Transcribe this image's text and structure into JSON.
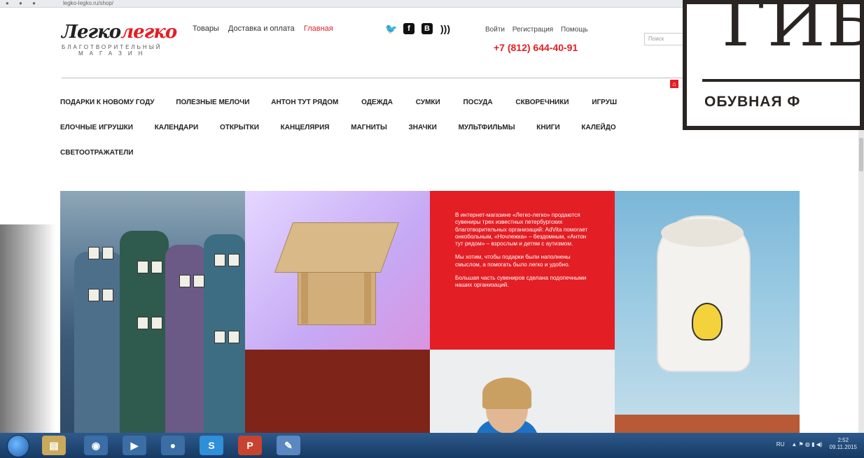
{
  "browser": {
    "url": "legko-legko.ru/shop/"
  },
  "logo": {
    "name_part1": "Легко",
    "name_part2": "легко",
    "line1": "БЛАГОТВОРИТЕЛЬНЫЙ",
    "line2": "МАГАЗИН"
  },
  "top_nav": [
    "Товары",
    "Доставка и оплата",
    "Главная"
  ],
  "social_icons": [
    "twitter-icon",
    "facebook-icon",
    "vk-icon",
    "rss-icon"
  ],
  "account_links": [
    "Войти",
    "Регистрация",
    "Помощь"
  ],
  "phone": "+7 (812) 644-40-91",
  "search": {
    "placeholder": "Поиск"
  },
  "menu_row1": [
    "ПОДАРКИ К НОВОМУ ГОДУ",
    "ПОЛЕЗНЫЕ МЕЛОЧИ",
    "АНТОН ТУТ РЯДОМ",
    "ОДЕЖДА",
    "СУМКИ",
    "ПОСУДА",
    "СКВОРЕЧНИКИ",
    "ИГРУШ"
  ],
  "menu_row2": [
    "ЕЛОЧНЫЕ ИГРУШКИ",
    "КАЛЕНДАРИ",
    "ОТКРЫТКИ",
    "КАНЦЕЛЯРИЯ",
    "МАГНИТЫ",
    "ЗНАЧКИ",
    "МУЛЬТФИЛЬМЫ",
    "КНИГИ",
    "КАЛЕЙДО"
  ],
  "menu_row3": [
    "СВЕТООТРАЖАТЕЛИ"
  ],
  "promo": {
    "p1": "В интернет-магазине «Легко-легко» продаются сувениры трех известных петербургских благотворительных организаций: AdVita помогает онкобольным, «Ночлежка» – бездомным, «Антон тут рядом» – взрослым и детям с аутизмом.",
    "p2": "Мы хотим, чтобы подарки были наполнены смыслом, а помогать было легко и удобно.",
    "p3": "Большая часть сувениров сделана подопечными наших организаций."
  },
  "overlay_badge": {
    "big_text": "ГИБ",
    "small_text": "ОБУВНАЯ Ф"
  },
  "taskbar": {
    "apps": [
      "explorer-icon",
      "chrome-icon",
      "media-player-icon",
      "firefox-icon",
      "skype-icon",
      "powerpoint-icon",
      "paint-icon"
    ],
    "lang": "RU",
    "time": "2:52",
    "date": "09.11.2015"
  },
  "colors": {
    "brand_red": "#e31e24",
    "taskbar": "#1f4a7a"
  }
}
